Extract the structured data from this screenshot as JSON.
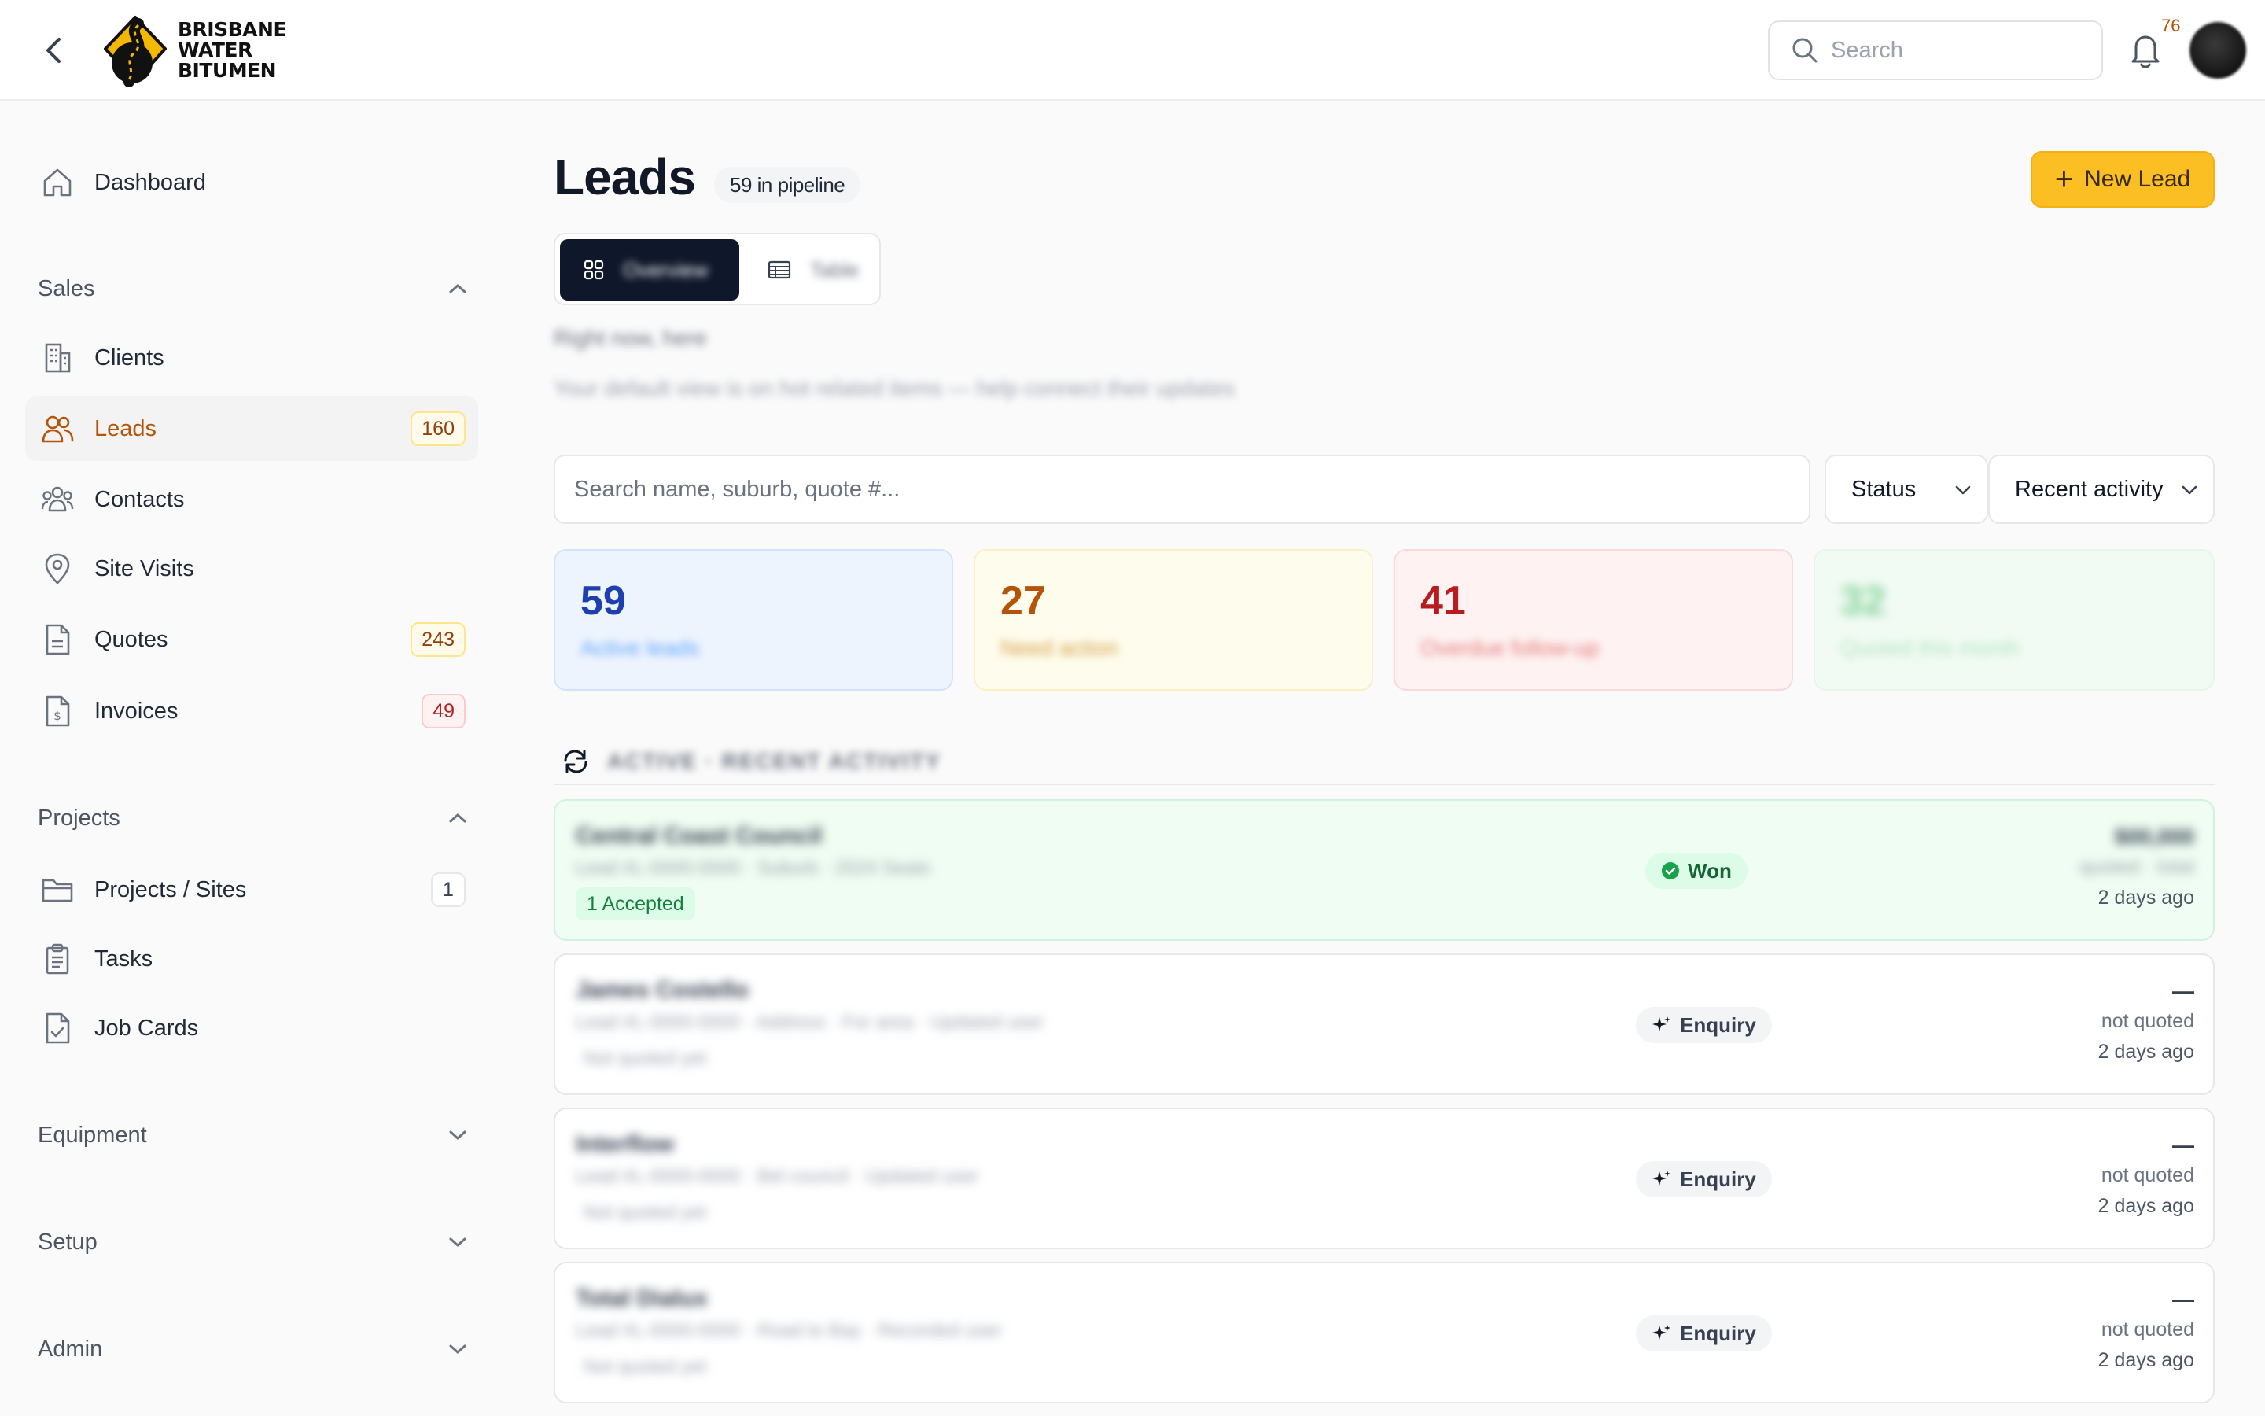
{
  "header": {
    "brand": [
      "BRISBANE",
      "WATER",
      "BITUMEN"
    ],
    "search_placeholder": "Search",
    "notification_count": "76"
  },
  "sidebar": {
    "dashboard": "Dashboard",
    "sections": {
      "sales": "Sales",
      "projects": "Projects",
      "equipment": "Equipment",
      "setup": "Setup",
      "admin": "Admin"
    },
    "items": {
      "clients": {
        "label": "Clients"
      },
      "leads": {
        "label": "Leads",
        "badge": "160"
      },
      "contacts": {
        "label": "Contacts"
      },
      "site_visits": {
        "label": "Site Visits"
      },
      "quotes": {
        "label": "Quotes",
        "badge": "243"
      },
      "invoices": {
        "label": "Invoices",
        "badge": "49"
      },
      "projects_sites": {
        "label": "Projects / Sites",
        "badge": "1"
      },
      "tasks": {
        "label": "Tasks"
      },
      "job_cards": {
        "label": "Job Cards"
      }
    }
  },
  "main": {
    "title": "Leads",
    "pipeline": "59 in pipeline",
    "new_lead": "New Lead",
    "view_toggle": {
      "overview": "Overview",
      "table": "Table"
    },
    "intro_title": "Right now, here",
    "intro_sub": "Your default view is on hot related items — help connect their updates",
    "filter_placeholder": "Search name, suburb, quote #...",
    "status_select": "Status",
    "sort_select": "Recent activity",
    "stats": [
      {
        "value": "59",
        "label": "Active leads",
        "color": "#1e40af"
      },
      {
        "value": "27",
        "label": "Need action",
        "color": "#b45309"
      },
      {
        "value": "41",
        "label": "Overdue follow-up",
        "color": "#b91c1c"
      },
      {
        "value": "32",
        "label": "Quoted this month",
        "color": "#16a34a"
      }
    ],
    "section_title": "ACTIVE · RECENT ACTIVITY",
    "leads": [
      {
        "name": "Central Coast Council",
        "meta": "Lead #L-0000-0000 · Suburb · 2024 Sealo",
        "accepted": "1 Accepted",
        "status": "Won",
        "amount": "$00,000",
        "amount_note": "quoted · total",
        "time": "2 days ago"
      },
      {
        "name": "James Costello",
        "meta": "Lead #L-0000-0000 · Address · For area · Updated user",
        "note": "Not quoted yet",
        "status": "Enquiry",
        "amount": "—",
        "amount_note": "not quoted",
        "time": "2 days ago"
      },
      {
        "name": "Interflow",
        "meta": "Lead #L-0000-0000 · Bel council · Updated user",
        "note": "Not quoted yet",
        "status": "Enquiry",
        "amount": "—",
        "amount_note": "not quoted",
        "time": "2 days ago"
      },
      {
        "name": "Total Dialux",
        "meta": "Lead #L-0000-0000 · Road to Bay · Recorded user",
        "note": "Not quoted yet",
        "status": "Enquiry",
        "amount": "—",
        "amount_note": "not quoted",
        "time": "2 days ago"
      }
    ]
  }
}
